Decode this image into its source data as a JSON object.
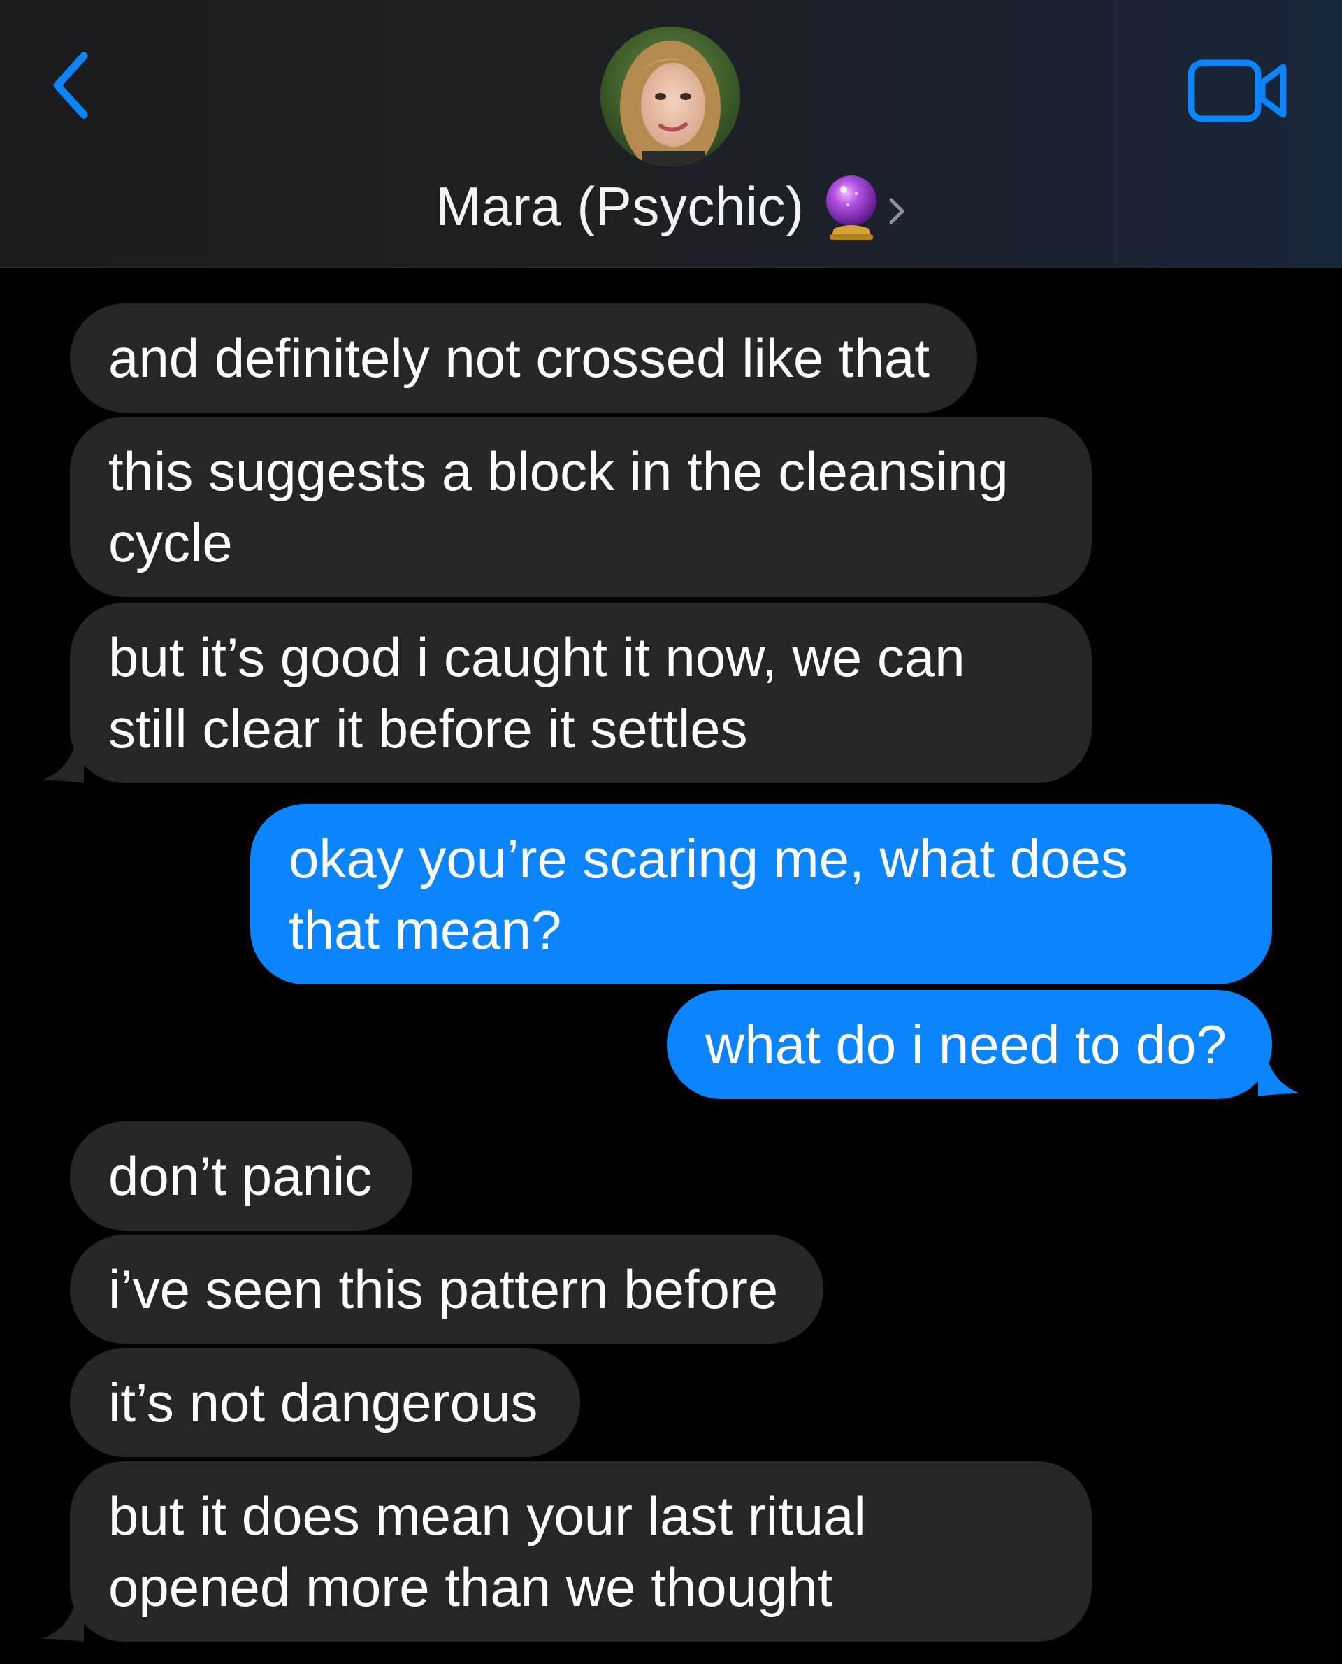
{
  "header": {
    "back_icon": "chevron-left-icon",
    "avatar_icon": "contact-avatar-photo",
    "contact_name": "Mara (Psychic)",
    "contact_emoji": "crystal-ball-icon",
    "details_icon": "chevron-right-icon",
    "video_icon": "video-camera-icon",
    "accent_color": "#0a84ff"
  },
  "messages": [
    {
      "sender": "contact",
      "lines": [
        "and definitely not crossed like that"
      ]
    },
    {
      "sender": "contact",
      "lines": [
        "this suggests a block in the cleansing",
        "cycle"
      ]
    },
    {
      "sender": "contact",
      "lines": [
        "but it’s good i caught it now, we can",
        "still clear it before it settles"
      ]
    },
    {
      "sender": "me",
      "lines": [
        "okay you’re scaring me, what does",
        "that mean?"
      ]
    },
    {
      "sender": "me",
      "lines": [
        "what do i need to do?"
      ]
    },
    {
      "sender": "contact",
      "lines": [
        "don’t panic"
      ]
    },
    {
      "sender": "contact",
      "lines": [
        "i’ve seen this pattern before"
      ]
    },
    {
      "sender": "contact",
      "lines": [
        "it’s not dangerous"
      ]
    },
    {
      "sender": "contact",
      "lines": [
        "but it does mean your last ritual",
        "opened more than we thought"
      ]
    }
  ],
  "colors": {
    "incoming_bubble": "#262629",
    "outgoing_bubble": "#0b84fe",
    "background": "#000000",
    "text": "#ffffff"
  }
}
